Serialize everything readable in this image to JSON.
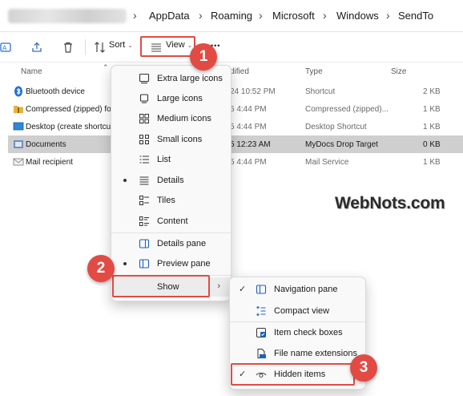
{
  "breadcrumb": [
    "AppData",
    "Roaming",
    "Microsoft",
    "Windows",
    "SendTo"
  ],
  "toolbar": {
    "sort_label": "Sort",
    "view_label": "View",
    "more_label": "•••"
  },
  "columns": {
    "name": "Name",
    "modified": "dified",
    "type": "Type",
    "size": "Size"
  },
  "rows": [
    {
      "name": "Bluetooth device",
      "modified": "24 10:52 PM",
      "type": "Shortcut",
      "size": "2 KB",
      "icon": "bluetooth-icon"
    },
    {
      "name": "Compressed (zipped) fold",
      "modified": "5 4:44 PM",
      "type": "Compressed (zipped)...",
      "size": "1 KB",
      "icon": "zip-folder-icon"
    },
    {
      "name": "Desktop (create shortcut)",
      "modified": "5 4:44 PM",
      "type": "Desktop Shortcut",
      "size": "1 KB",
      "icon": "desktop-icon"
    },
    {
      "name": "Documents",
      "modified": "5 12:23 AM",
      "type": "MyDocs Drop Target",
      "size": "0 KB",
      "icon": "documents-icon",
      "selected": true
    },
    {
      "name": "Mail recipient",
      "modified": "5 4:44 PM",
      "type": "Mail Service",
      "size": "1 KB",
      "icon": "mail-icon"
    }
  ],
  "view_menu": {
    "items": [
      {
        "label": "Extra large icons",
        "icon": "extra-large-icons-icon"
      },
      {
        "label": "Large icons",
        "icon": "large-icons-icon"
      },
      {
        "label": "Medium icons",
        "icon": "medium-icons-icon"
      },
      {
        "label": "Small icons",
        "icon": "small-icons-icon"
      },
      {
        "label": "List",
        "icon": "list-icon"
      },
      {
        "label": "Details",
        "icon": "details-icon",
        "selected": true
      },
      {
        "label": "Tiles",
        "icon": "tiles-icon"
      },
      {
        "label": "Content",
        "icon": "content-icon"
      }
    ],
    "panes": [
      {
        "label": "Details pane",
        "icon": "details-pane-icon"
      },
      {
        "label": "Preview pane",
        "icon": "preview-pane-icon",
        "selected": true
      }
    ],
    "show_label": "Show"
  },
  "show_menu": {
    "items": [
      {
        "label": "Navigation pane",
        "checked": true,
        "icon": "navigation-pane-icon"
      },
      {
        "label": "Compact view",
        "checked": false,
        "icon": "compact-view-icon"
      },
      {
        "label": "Item check boxes",
        "checked": false,
        "icon": "check-box-icon"
      },
      {
        "label": "File name extensions",
        "checked": false,
        "icon": "file-extension-icon"
      },
      {
        "label": "Hidden items",
        "checked": true,
        "icon": "eye-icon"
      }
    ]
  },
  "watermark": "WebNots.com",
  "callouts": [
    "1",
    "2",
    "3"
  ],
  "colors": {
    "highlight": "#e24b43",
    "selected_row": "#cfcfcf",
    "menu_bg": "#f9f9f9"
  }
}
